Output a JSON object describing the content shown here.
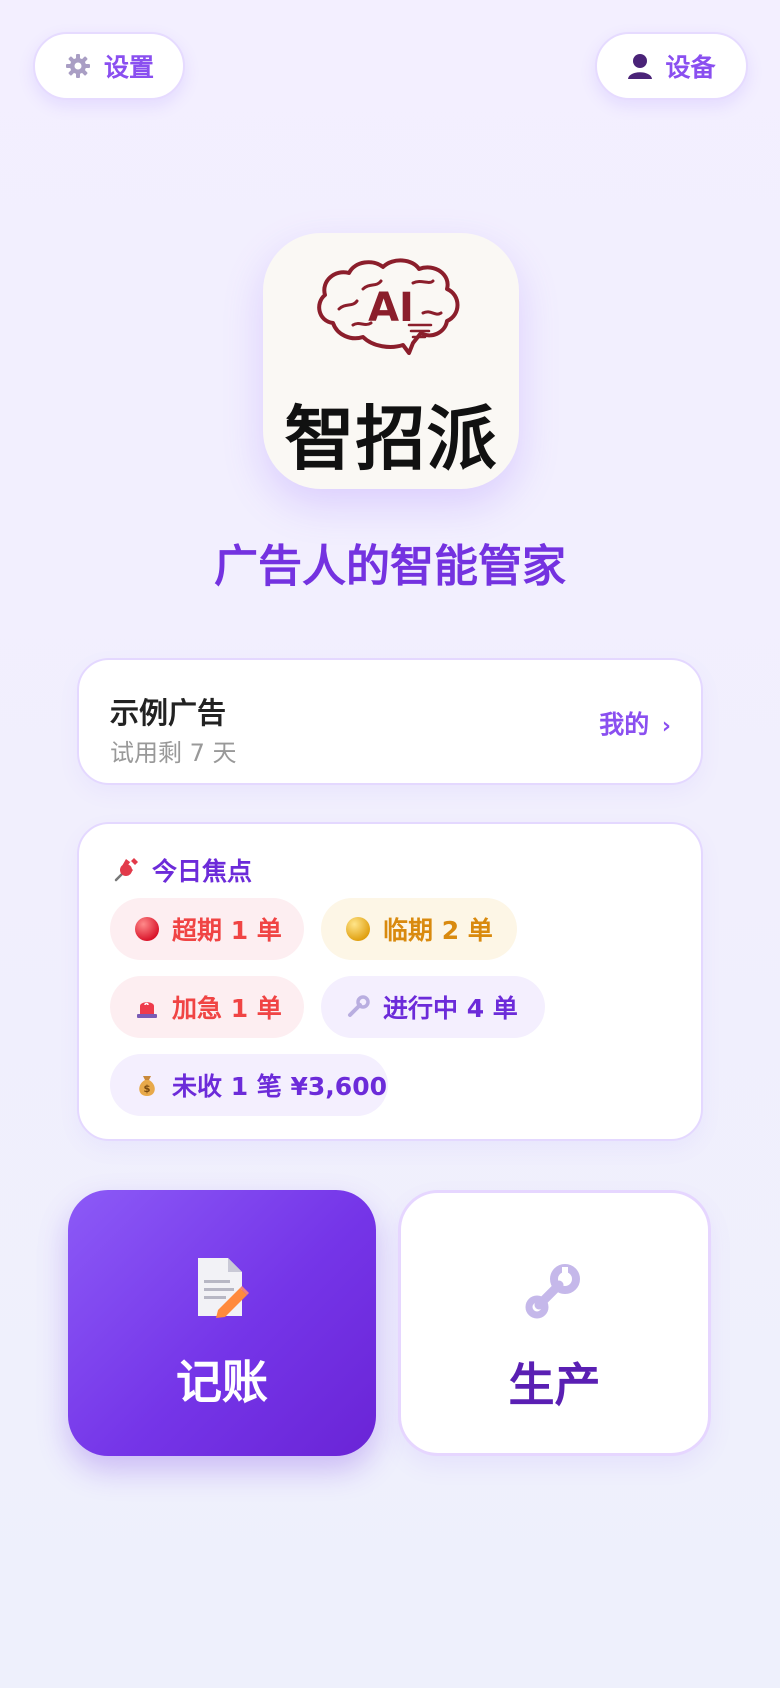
{
  "header": {
    "settings_label": "设置",
    "settings_icon": "gear-icon",
    "device_label": "设备",
    "device_icon": "user-icon"
  },
  "logo": {
    "badge_text": "AI",
    "brand_name": "智招派",
    "icon": "brain-icon"
  },
  "tagline": "广告人的智能管家",
  "account": {
    "name": "示例广告",
    "trial": "试用剩 7 天",
    "mine_label": "我的",
    "mine_arrow": "›"
  },
  "focus": {
    "title": "今日焦点",
    "title_icon": "pushpin-icon",
    "chips": [
      {
        "label": "超期 1 单",
        "icon": "red-circle-icon"
      },
      {
        "label": "临期 2 单",
        "icon": "yellow-circle-icon"
      },
      {
        "label": "加急 1 单",
        "icon": "siren-icon"
      },
      {
        "label": "进行中 4 单",
        "icon": "wrench-icon"
      },
      {
        "label": "未收 1 笔 ¥3,600",
        "icon": "money-bag-icon"
      }
    ]
  },
  "tiles": {
    "bookkeeping": {
      "label": "记账",
      "icon": "memo-icon"
    },
    "production": {
      "label": "生产",
      "icon": "wrench-icon"
    }
  },
  "colors": {
    "accent": "#7432e0",
    "danger": "#f04444",
    "warning": "#d98a0e",
    "background": "#f3efff"
  }
}
